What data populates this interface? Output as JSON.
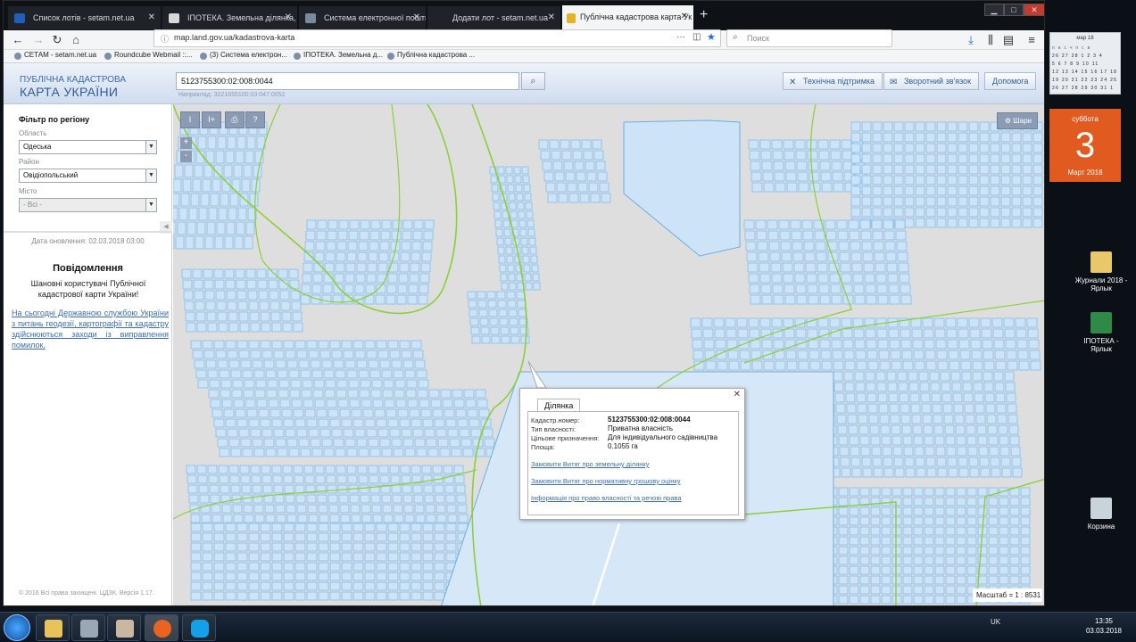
{
  "browser": {
    "tabs": [
      {
        "label": "Список лотів - setam.net.ua"
      },
      {
        "label": "ІПОТЕКА. Земельна ділянка, загал"
      },
      {
        "label": "Система електронної пошти"
      },
      {
        "label": "Додати лот - setam.net.ua"
      },
      {
        "label": "Публічна кадастрова карта Ук"
      }
    ],
    "url": "map.land.gov.ua/kadastrova-karta",
    "search_placeholder": "Поиск",
    "bookmarks": [
      "СЕТАМ - setam.net.ua",
      "Roundcube Webmail ::...",
      "(3) Система електрон...",
      "ІПОТЕКА. Земельна д...",
      "Публічна кадастрова ..."
    ]
  },
  "header": {
    "logo_line1": "ПУБЛІЧНА КАДАСТРОВА",
    "logo_line2": "КАРТА УКРАЇНИ",
    "search_value": "5123755300:02:008:0044",
    "search_example": "Наприклад: 3221655100:03:047:0052",
    "buttons": {
      "support": "Технічна підтримка",
      "feedback": "Зворотний зв'язок",
      "help": "Допомога"
    }
  },
  "sidebar": {
    "filter_title": "Фільтр по регіону",
    "region_label": "Область",
    "region_value": "Одеська",
    "district_label": "Район",
    "district_value": "Овідіопольський",
    "city_label": "Місто",
    "city_value": "- Всі -",
    "updated": "Дата оновлення: 02.03.2018 03:00",
    "notice_title": "Повідомлення",
    "notice_body": "Шановні користувачі Публічної кадастрової карти України!",
    "notice_link": "На сьогодні Державною службою України з питань геодезії, картографії та кадастру здійснюються заходи із виправлення помилок.",
    "copyright": "© 2016 Всі права захищені. ЦДЗК. Версія 1.17."
  },
  "map": {
    "tools": [
      "I",
      "I+",
      "print",
      "?"
    ],
    "zoom_in": "+",
    "zoom_out": "-",
    "layers_label": "Шари",
    "scale_label": "Масштаб = 1 : 8531",
    "parcel_fill": "#cde3f7",
    "parcel_stroke": "#6aaee5",
    "boundary_color": "#8ccf3a"
  },
  "popup": {
    "tab": "Ділянка",
    "rows": [
      {
        "label": "Кадастр.номер:",
        "value": "5123755300:02:008:0044"
      },
      {
        "label": "Тип власності:",
        "value": "Приватна власність"
      },
      {
        "label": "Цільове призначення:",
        "value": "Для індивідуального садівництва"
      },
      {
        "label": "Площа:",
        "value": "0.1055 га"
      }
    ],
    "links": [
      "Замовити Витяг про земельну ділянку",
      "Замовити Витяг про нормативну грошову оцінку",
      "Інформація про право власності та речові права"
    ]
  },
  "desktop": {
    "calendar_month": "мар 18",
    "calendar_rows": [
      "п в с ч п с в",
      "26 27 28 1 2 3 4",
      "5 6 7 8 9 10 11",
      "12 13 14 15 16 17 18",
      "19 20 21 22 23 24 25",
      "26 27 28 29 30 31 1"
    ],
    "day_name": "суббота",
    "day_number": "3",
    "day_month": "Март 2018",
    "icons": [
      {
        "label": "Журнали 2018 - Ярлык"
      },
      {
        "label": "ІПОТЕКА - Ярлык"
      },
      {
        "label": "Корзина"
      }
    ]
  },
  "taskbar": {
    "lang": "UK",
    "time": "13:35",
    "date": "03.03.2018"
  }
}
